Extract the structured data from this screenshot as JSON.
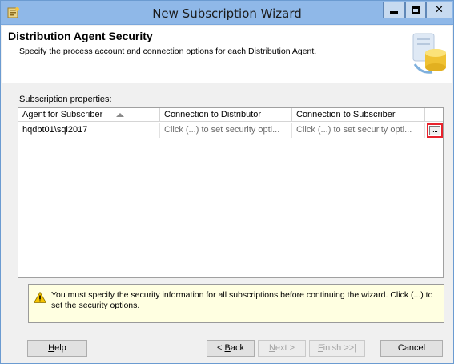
{
  "window": {
    "title": "New Subscription Wizard"
  },
  "header": {
    "title": "Distribution Agent Security",
    "subtitle": "Specify the process account and connection options for each Distribution Agent."
  },
  "subscription_properties": {
    "label": "Subscription properties:",
    "columns": [
      "Agent for Subscriber",
      "Connection to Distributor",
      "Connection to Subscriber",
      ""
    ],
    "sort_column": "Agent for Subscriber",
    "rows": [
      {
        "agent": "hqdbt01\\sql2017",
        "distributor_connection": "Click (...) to set security opti...",
        "subscriber_connection": "Click (...) to set security opti...",
        "button_label": "..."
      }
    ]
  },
  "warning": {
    "icon": "warning-icon",
    "text": "You must specify the security information for all subscriptions before continuing the wizard. Click (...) to set the security options."
  },
  "buttons": {
    "help_prefix": "",
    "help_mnemonic": "H",
    "help_rest": "elp",
    "back_prefix": "< ",
    "back_mnemonic": "B",
    "back_rest": "ack",
    "next_prefix": "",
    "next_mnemonic": "N",
    "next_rest": "ext >",
    "finish_prefix": "",
    "finish_mnemonic": "F",
    "finish_rest": "inish >>|",
    "cancel": "Cancel"
  },
  "colors": {
    "titlebar": "#8fb8e8",
    "highlight_border": "#e8222c",
    "warning_bg": "#ffffe1"
  }
}
